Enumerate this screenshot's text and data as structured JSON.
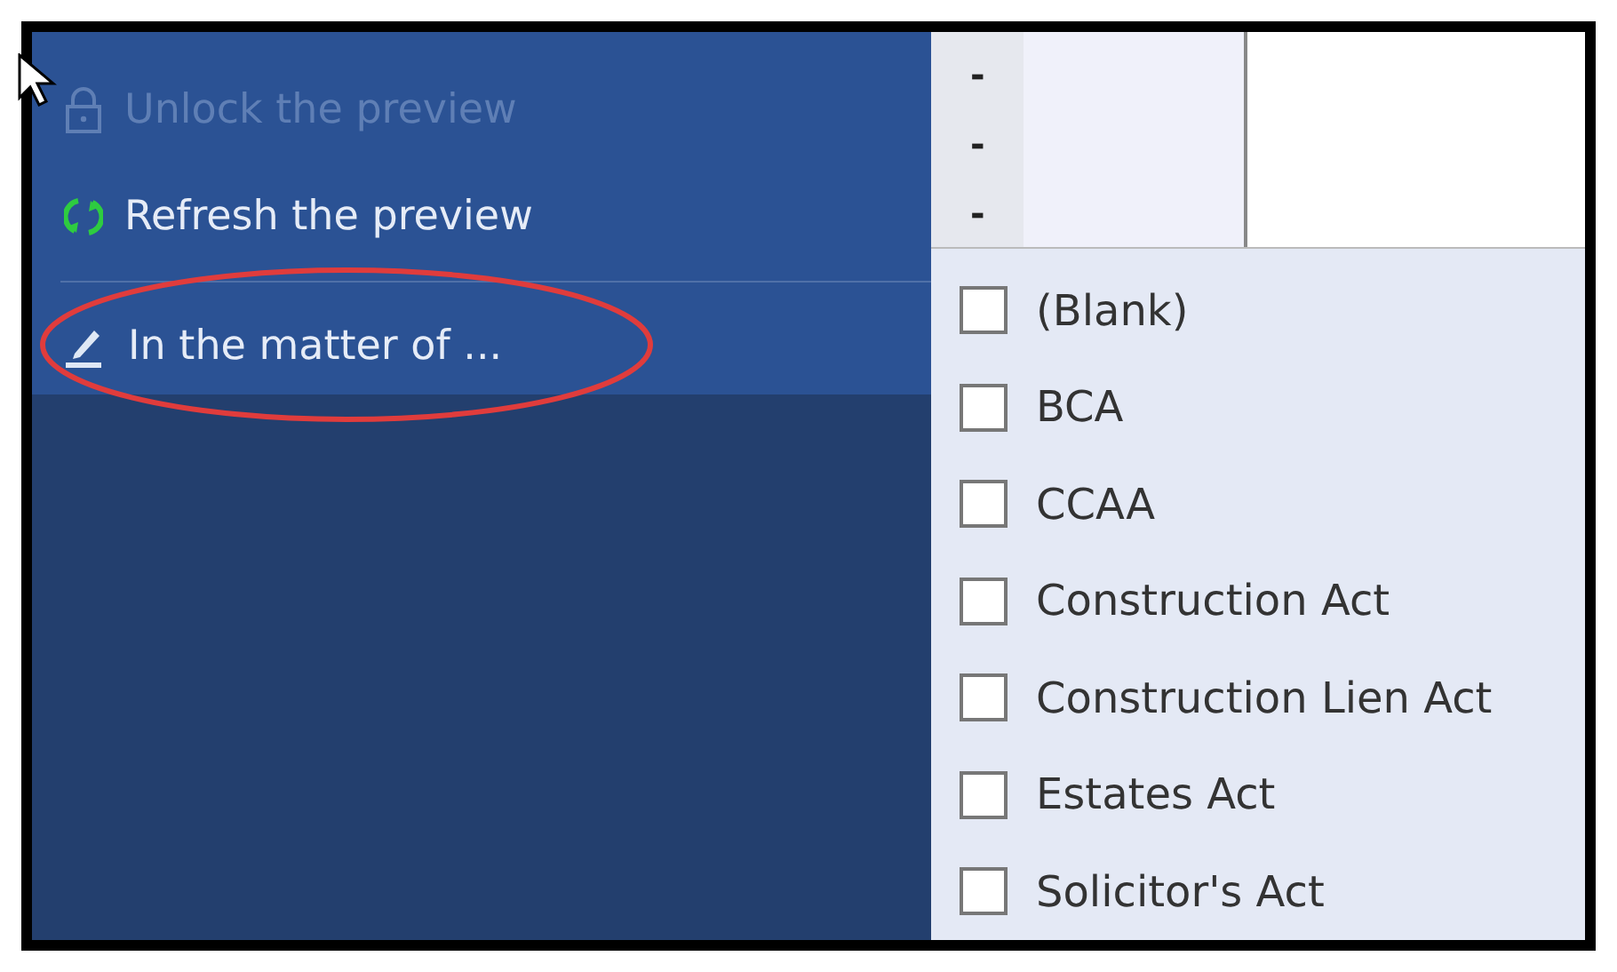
{
  "menu": {
    "items": [
      {
        "kind": "lock",
        "label": "Unlock the preview",
        "disabled": true,
        "circled": false
      },
      {
        "kind": "refresh",
        "label": "Refresh the preview",
        "disabled": false,
        "circled": false
      },
      {
        "kind": "divider"
      },
      {
        "kind": "edit",
        "label": "In the matter of ...",
        "disabled": false,
        "circled": true
      }
    ]
  },
  "preview": {
    "markers": [
      "-",
      "-",
      "-"
    ]
  },
  "filter_list": {
    "options": [
      {
        "label": "(Blank)",
        "checked": false
      },
      {
        "label": "BCA",
        "checked": false
      },
      {
        "label": "CCAA",
        "checked": false
      },
      {
        "label": "Construction Act",
        "checked": false
      },
      {
        "label": "Construction Lien Act",
        "checked": false
      },
      {
        "label": "Estates Act",
        "checked": false
      },
      {
        "label": "Solicitor's Act",
        "checked": false
      }
    ]
  }
}
